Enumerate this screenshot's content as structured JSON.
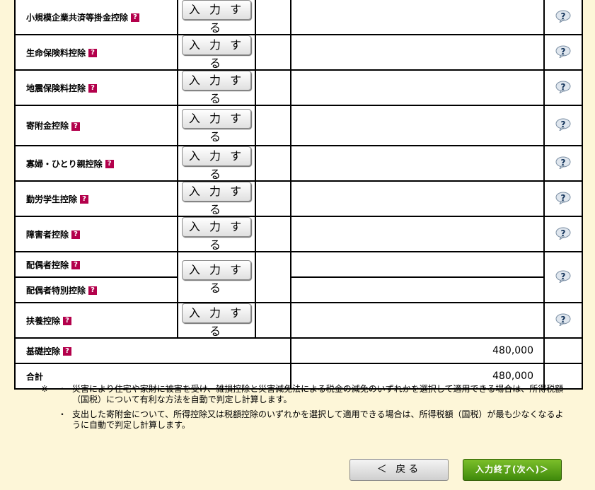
{
  "rows": [
    {
      "label": "小規模企業共済等掛金控除",
      "button": "入 力 す る"
    },
    {
      "label": "生命保険料控除",
      "button": "入 力 す る"
    },
    {
      "label": "地震保険料控除",
      "button": "入 力 す る"
    },
    {
      "label": "寄附金控除",
      "button": "入 力 す る"
    },
    {
      "label": "寡婦・ひとり親控除",
      "button": "入 力 す る"
    },
    {
      "label": "勤労学生控除",
      "button": "入 力 す る"
    },
    {
      "label": "障害者控除",
      "button": "入 力 す る"
    },
    {
      "label": "配偶者控除",
      "label2": "配偶者特別控除",
      "button": "入 力 す る"
    },
    {
      "label": "扶養控除",
      "button": "入 力 す る"
    }
  ],
  "basic": {
    "label": "基礎控除",
    "amount": "480,000"
  },
  "total": {
    "label": "合計",
    "amount": "480,000"
  },
  "qmark": "?",
  "notes": {
    "mark": "※",
    "bullet": "・",
    "note1": "災害により住宅や家財に被害を受け、雑損控除と災害減免法による税金の減免のいずれかを選択して適用できる場合は、所得税額（国税）について有利な方法を自動で判定し計算します。",
    "note2": "支出した寄附金について、所得控除又は税額控除のいずれかを選択して適用できる場合は、所得税額（国税）が最も少なくなるように自動で判定し計算します。"
  },
  "buttons": {
    "back": "＜ 戻る",
    "next": "入力終了(次へ)＞"
  },
  "colors": {
    "background": "#fdf6d8",
    "label_bg": "#dcfbfb",
    "qmark": "#b3004b",
    "next": "#4a9a12"
  },
  "icons": {
    "help": "help-bubble-icon",
    "qmark": "question-mark-icon"
  }
}
